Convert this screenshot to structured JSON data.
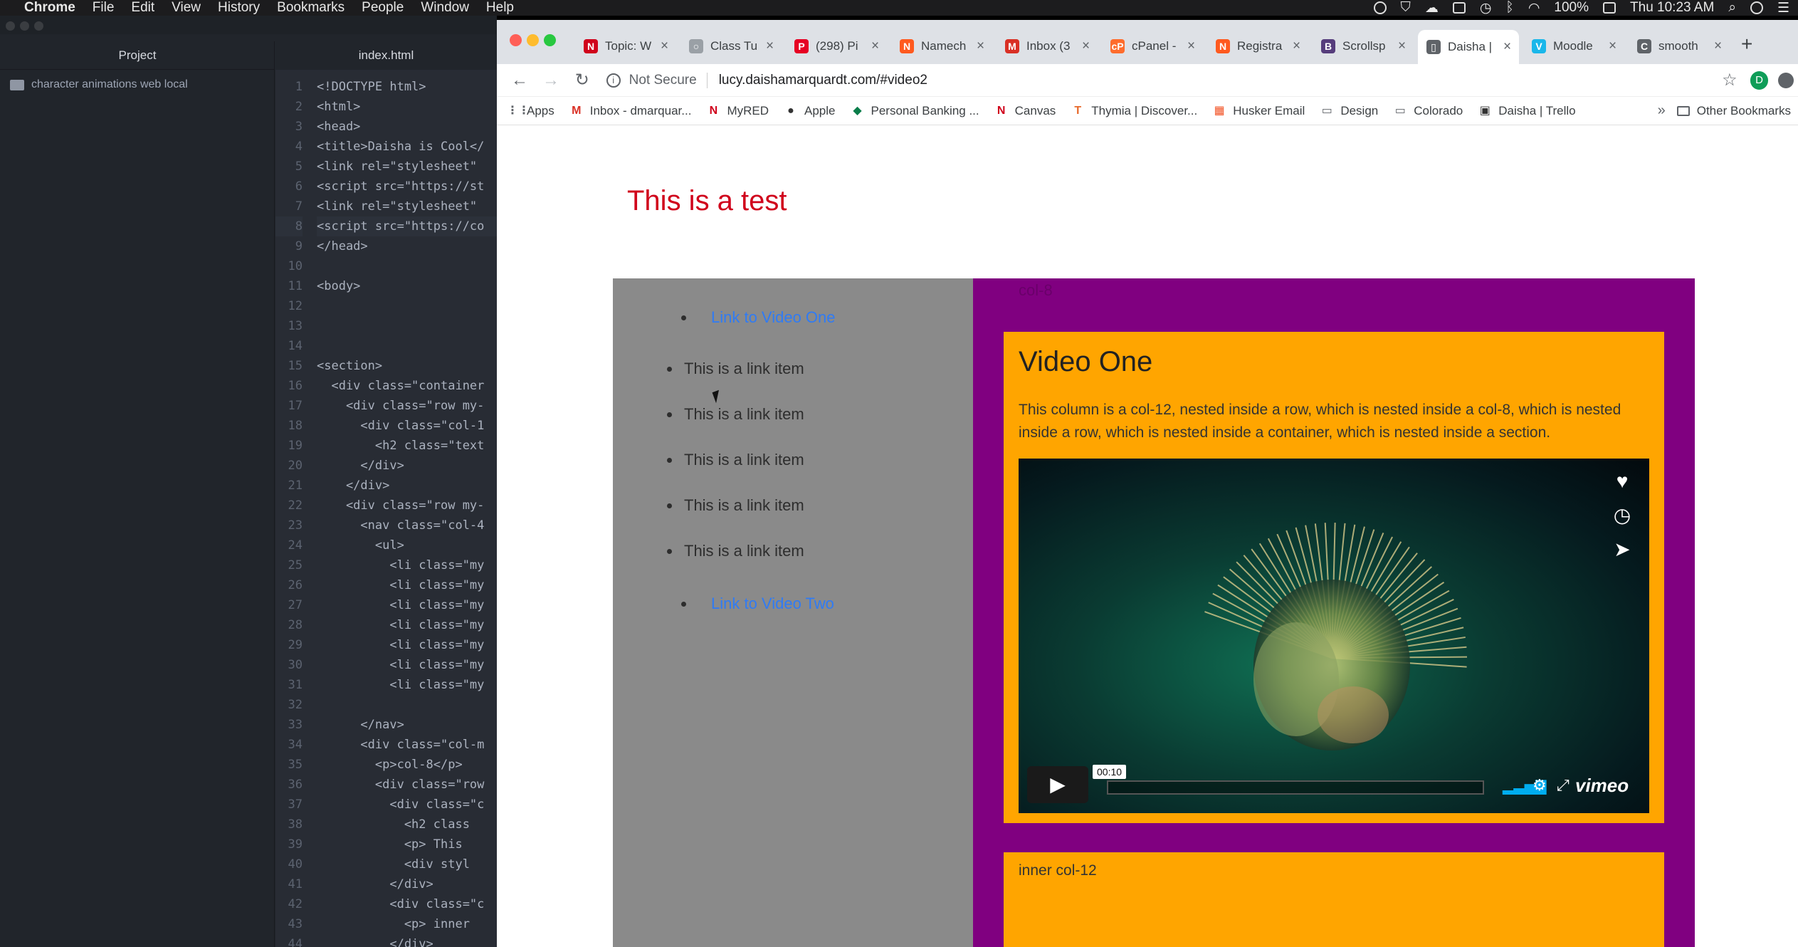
{
  "menubar": {
    "app": "Chrome",
    "items": [
      "File",
      "Edit",
      "View",
      "History",
      "Bookmarks",
      "People",
      "Window",
      "Help"
    ],
    "battery": "100%",
    "clock": "Thu 10:23 AM"
  },
  "editor": {
    "project_tab": "Project",
    "file_tab": "index.html",
    "tree_item": "character animations web local",
    "lines": [
      "<!DOCTYPE html>",
      "<html>",
      "<head>",
      "<title>Daisha is Cool</",
      "<link rel=\"stylesheet\"",
      "<script src=\"https://st",
      "<link rel=\"stylesheet\"",
      "<script src=\"https://co",
      "</head>",
      "",
      "<body>",
      "",
      "",
      "",
      "<section>",
      "  <div class=\"container",
      "    <div class=\"row my-",
      "      <div class=\"col-1",
      "        <h2 class=\"text",
      "      </div>",
      "    </div>",
      "    <div class=\"row my-",
      "      <nav class=\"col-4",
      "        <ul>",
      "          <li class=\"my",
      "          <li class=\"my",
      "          <li class=\"my",
      "          <li class=\"my",
      "          <li class=\"my",
      "          <li class=\"my",
      "          <li class=\"my",
      "",
      "      </nav>",
      "      <div class=\"col-m",
      "        <p>col-8</p>",
      "        <div class=\"row",
      "          <div class=\"c",
      "            <h2 class",
      "            <p> This",
      "            <div styl",
      "          </div>",
      "          <div class=\"c",
      "            <p> inner",
      "          </div>"
    ]
  },
  "browser": {
    "tabs": [
      {
        "title": "Topic: W",
        "icon": "N",
        "color": "#d0021b"
      },
      {
        "title": "Class Tu",
        "icon": "○",
        "color": "#9aa0a6"
      },
      {
        "title": "(298) Pi",
        "icon": "P",
        "color": "#e60023"
      },
      {
        "title": "Namech",
        "icon": "N",
        "color": "#ff5a1f"
      },
      {
        "title": "Inbox (3",
        "icon": "M",
        "color": "#d93025"
      },
      {
        "title": "cPanel -",
        "icon": "cP",
        "color": "#ff6c2c"
      },
      {
        "title": "Registra",
        "icon": "N",
        "color": "#ff5a1f"
      },
      {
        "title": "Scrollsp",
        "icon": "B",
        "color": "#563d7c"
      },
      {
        "title": "Daisha |",
        "icon": "▯",
        "color": "#5f6368"
      },
      {
        "title": "Moodle",
        "icon": "V",
        "color": "#1ab7ea"
      },
      {
        "title": "smooth",
        "icon": "C",
        "color": "#5f6368"
      }
    ],
    "not_secure": "Not Secure",
    "url": "lucy.daishamarquardt.com/#video2",
    "profile_initial": "D",
    "bookmarks": [
      {
        "label": "Apps",
        "icon": "⋮⋮",
        "color": "#5f6368"
      },
      {
        "label": "Inbox - dmarquar...",
        "icon": "M",
        "color": "#d93025"
      },
      {
        "label": "MyRED",
        "icon": "N",
        "color": "#d0021b"
      },
      {
        "label": "Apple",
        "icon": "●",
        "color": "#333"
      },
      {
        "label": "Personal Banking ...",
        "icon": "◆",
        "color": "#0a7d4a"
      },
      {
        "label": "Canvas",
        "icon": "N",
        "color": "#d0021b"
      },
      {
        "label": "Thymia | Discover...",
        "icon": "T",
        "color": "#e86a2c"
      },
      {
        "label": "Husker Email",
        "icon": "▦",
        "color": "#f25022"
      },
      {
        "label": "Design",
        "icon": "▭",
        "color": "#5f6368"
      },
      {
        "label": "Colorado",
        "icon": "▭",
        "color": "#5f6368"
      },
      {
        "label": "Daisha | Trello",
        "icon": "▣",
        "color": "#333"
      }
    ],
    "bookmarks_more": "»",
    "other_bookmarks": "Other Bookmarks"
  },
  "page": {
    "title": "This is a test",
    "nav": {
      "link1": "Link to Video One",
      "items": [
        "This is a link item",
        "This is a link item",
        "This is a link item",
        "This is a link item",
        "This is a link item"
      ],
      "link2": "Link to Video Two"
    },
    "col8_label": "col-8",
    "video": {
      "title": "Video One",
      "description": "This column is a col-12, nested inside a row, which is nested inside a col-8, which is nested inside a row, which is nested inside a container, which is nested inside a section.",
      "timecode": "00:10",
      "brand": "vimeo",
      "progress": 0.0
    },
    "inner_label": "inner col-12"
  }
}
